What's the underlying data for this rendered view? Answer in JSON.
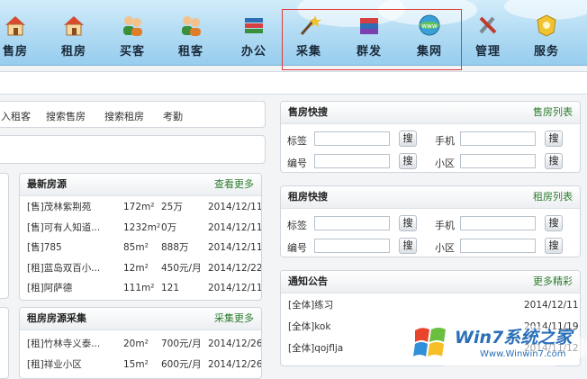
{
  "nav": {
    "items": [
      {
        "label": "售房",
        "icon": "house-icon"
      },
      {
        "label": "租房",
        "icon": "house-icon"
      },
      {
        "label": "买客",
        "icon": "users-icon"
      },
      {
        "label": "租客",
        "icon": "users-icon"
      },
      {
        "label": "办公",
        "icon": "books-icon"
      },
      {
        "label": "采集",
        "icon": "magic-wand-icon"
      },
      {
        "label": "群发",
        "icon": "package-icon"
      },
      {
        "label": "集网",
        "icon": "globe-www-icon"
      },
      {
        "label": "管理",
        "icon": "tools-icon"
      },
      {
        "label": "服务",
        "icon": "badge-icon"
      }
    ]
  },
  "subnav": {
    "links": [
      "入租客",
      "搜索售房",
      "搜索租房",
      "考勤"
    ]
  },
  "sale_search": {
    "title": "售房快搜",
    "more": "售房列表",
    "fields": [
      "标签",
      "手机",
      "编号",
      "小区"
    ],
    "button": "搜"
  },
  "rent_search": {
    "title": "租房快搜",
    "more": "租房列表",
    "fields": [
      "标签",
      "手机",
      "编号",
      "小区"
    ],
    "button": "搜"
  },
  "latest_listings": {
    "title": "最新房源",
    "more": "查看更多",
    "rows": [
      {
        "name": "[售]茂林紫荆苑",
        "area": "172m²",
        "price": "25万",
        "date": "2014/12/11"
      },
      {
        "name": "[售]可有人知道...",
        "area": "1232m²",
        "price": "0万",
        "date": "2014/12/11"
      },
      {
        "name": "[售]785",
        "area": "85m²",
        "price": "888万",
        "date": "2014/12/11"
      },
      {
        "name": "[租]蓝岛双百小...",
        "area": "12m²",
        "price": "450元/月",
        "date": "2014/12/22"
      },
      {
        "name": "[租]阿萨德",
        "area": "111m²",
        "price": "121",
        "date": "2014/12/11"
      }
    ]
  },
  "rent_collection": {
    "title": "租房房源采集",
    "more": "采集更多",
    "rows": [
      {
        "name": "[租]竹林寺义泰...",
        "area": "20m²",
        "price": "700元/月",
        "date": "2014/12/26"
      },
      {
        "name": "[租]祥业小区",
        "area": "15m²",
        "price": "600元/月",
        "date": "2014/12/26"
      }
    ]
  },
  "notices": {
    "title": "通知公告",
    "more": "更多精彩",
    "rows": [
      {
        "text": "[全体]练习",
        "date": "2014/12/11"
      },
      {
        "text": "[全体]kok",
        "date": "2014/11/19"
      },
      {
        "text": "[全体]qojflja",
        "date": "2014/11/12"
      }
    ]
  },
  "watermark": {
    "brand": "Win7系统之家",
    "url": "Www.Winwin7.com"
  },
  "colors": {
    "accent_green": "#2d7d2d",
    "highlight_red": "#e23a3a",
    "nav_blue": "#b5ddf4"
  }
}
